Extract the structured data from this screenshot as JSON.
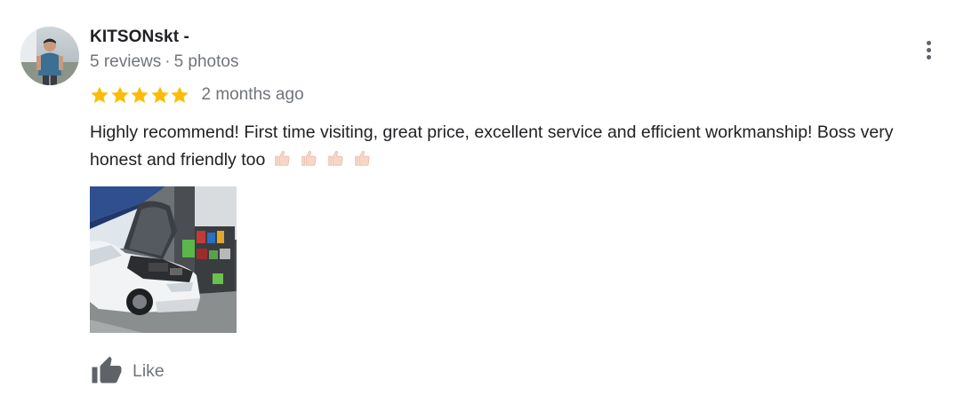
{
  "review": {
    "reviewer_name": "KITSONskt -",
    "reviews_count": "5 reviews",
    "separator": "·",
    "photos_count": "5 photos",
    "rating": 5,
    "date": "2 months ago",
    "text_line1": "Highly recommend! First time visiting, great price, excellent service and efficient workmanship! Boss very",
    "text_line2": "honest and friendly too",
    "emoji_count": 4,
    "emoji_name": "thumbs-up-light-skin-emoji",
    "like_label": "Like"
  },
  "icons": {
    "menu": "more-vert-icon",
    "star": "star-icon",
    "like": "thumb-up-icon"
  },
  "colors": {
    "star": "#fbbc04",
    "name": "#202124",
    "secondary": "#70757a",
    "icon": "#5f6368"
  }
}
